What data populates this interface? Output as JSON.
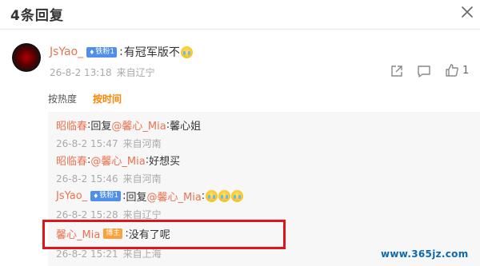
{
  "dialog": {
    "title": "4条回复"
  },
  "main_comment": {
    "username": "JsYao_",
    "fan_badge": "铁粉1",
    "sep": ":",
    "text": "有冠军版不",
    "emoji": "cry-laugh-emoji",
    "time": "26-8-2 13:18",
    "location": "来自辽宁",
    "like_count": "1"
  },
  "sort": {
    "hot": "按热度",
    "time": "按时间"
  },
  "replies": [
    {
      "user": "昭临春",
      "reply_prefix": "回复",
      "mention": "@馨心_Mia",
      "text": "馨心姐",
      "time": "26-8-2 15:47",
      "location": "来自河南"
    },
    {
      "user": "昭临春",
      "mention": "@馨心_Mia",
      "text": "好想买",
      "time": "26-8-2 15:46",
      "location": "来自河南"
    },
    {
      "user": "JsYao_",
      "fan_badge": "铁粉1",
      "reply_prefix": "回复",
      "mention": "@馨心_Mia",
      "time": "26-8-2 15:28",
      "location": "来自辽宁"
    },
    {
      "user": "馨心_Mia",
      "host_badge": "博主",
      "text": "没有了呢",
      "time": "26-8-2 15:21",
      "location": "来自上海"
    }
  ],
  "watermark": "www.365jz.com",
  "colors": {
    "accent_orange": "#ff8200",
    "username": "#eb7350",
    "badge_blue": "#4f8fe9",
    "highlight_red": "#e0151b"
  }
}
